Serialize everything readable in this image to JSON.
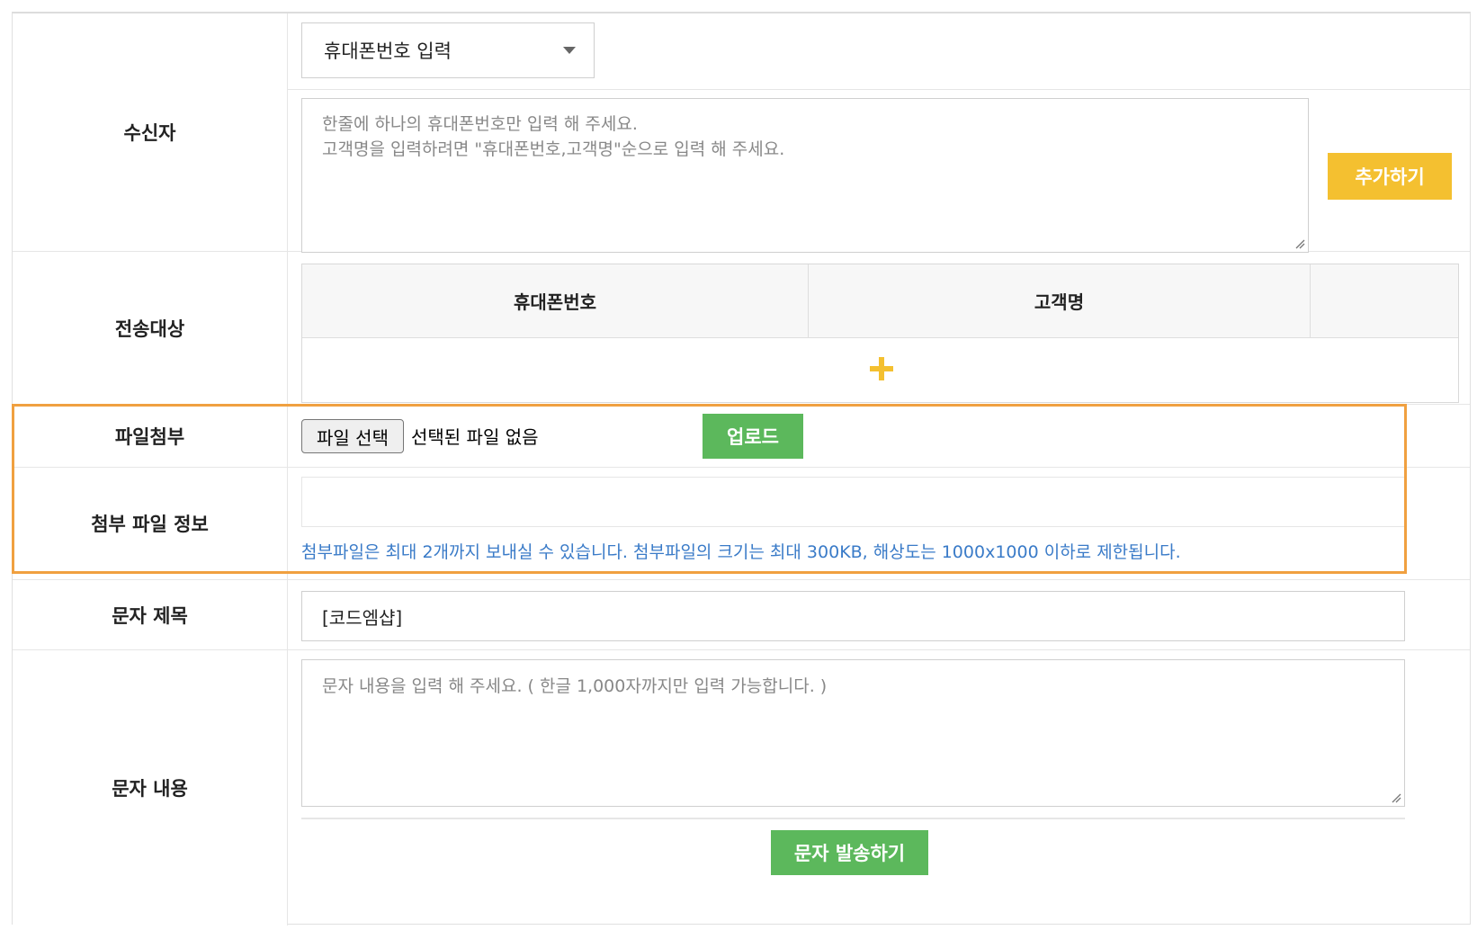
{
  "recipient": {
    "label": "수신자",
    "select_value": "휴대폰번호 입력",
    "textarea_placeholder_line1": "한줄에 하나의 휴대폰번호만 입력 해 주세요.",
    "textarea_placeholder_line2": "고객명을 입력하려면 \"휴대폰번호,고객명\"순으로 입력 해 주세요.",
    "add_button": "추가하기"
  },
  "target": {
    "label": "전송대상",
    "columns": [
      "휴대폰번호",
      "고객명",
      ""
    ]
  },
  "attachment": {
    "label": "파일첨부",
    "choose_button": "파일 선택",
    "status": "선택된 파일 없음",
    "upload_button": "업로드"
  },
  "attachment_info": {
    "label": "첨부 파일 정보",
    "notice": "첨부파일은 최대 2개까지 보내실 수 있습니다. 첨부파일의 크기는 최대 300KB, 해상도는 1000x1000 이하로 제한됩니다."
  },
  "subject": {
    "label": "문자 제목",
    "value": "[코드엠샵]"
  },
  "message": {
    "label": "문자 내용",
    "placeholder": "문자 내용을 입력 해 주세요. ( 한글 1,000자까지만 입력 가능합니다. )",
    "send_button": "문자 발송하기"
  },
  "colors": {
    "accent_yellow": "#f4c030",
    "accent_green": "#5cb85c",
    "highlight_orange": "#f0a040",
    "notice_blue": "#3a7bc8"
  }
}
